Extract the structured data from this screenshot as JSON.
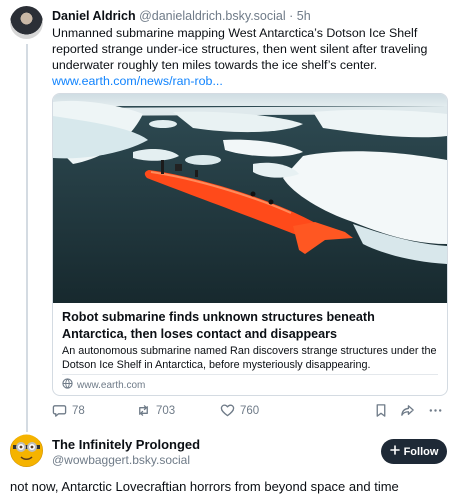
{
  "post1": {
    "author_name": "Daniel Aldrich",
    "author_handle": "@danielaldrich.bsky.social",
    "time": "· 5h",
    "text": "Unmanned submarine mapping West Antarctica’s Dotson Ice Shelf reported strange under-ice structures, then went silent after traveling underwater roughly ten miles towards the ice shelf’s center.",
    "link": "www.earth.com/news/ran-rob...",
    "embed": {
      "title": "Robot submarine finds unknown structures beneath Antarctica, then loses contact and disappears",
      "description": "An autonomous submarine named Ran discovers strange structures under the Dotson Ice Shelf in Antarctica, before mysteriously disappearing.",
      "domain": "www.earth.com"
    },
    "actions": {
      "reply_count": "78",
      "repost_count": "703",
      "like_count": "760"
    }
  },
  "post2": {
    "author_name": "The Infinitely Prolonged",
    "author_handle": "@wowbaggert.bsky.social",
    "follow_label": "Follow",
    "text": "not now, Antarctic Lovecraftian horrors from beyond space and time"
  },
  "colors": {
    "accent_link": "#1083fe",
    "muted": "#6f7b88",
    "follow_bg": "#1e2936",
    "submarine": "#ff4a1a"
  },
  "icons": [
    "globe-icon",
    "reply-icon",
    "repost-icon",
    "like-icon",
    "bookmark-icon",
    "share-icon",
    "more-icon",
    "plus-icon"
  ]
}
